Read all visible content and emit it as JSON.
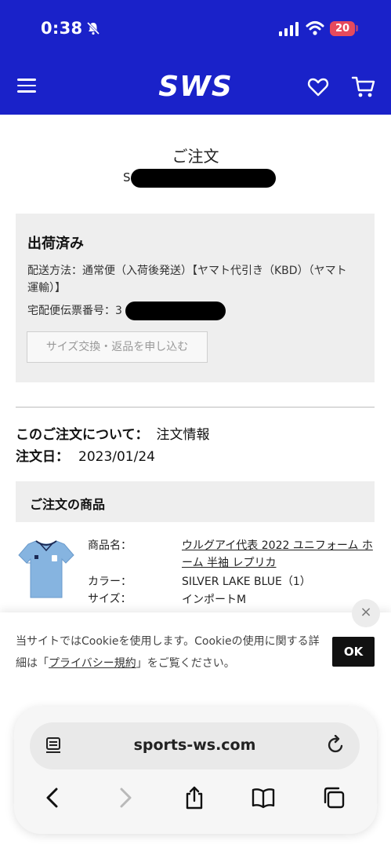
{
  "status_bar": {
    "time": "0:38",
    "battery": "20"
  },
  "header": {
    "logo": "SWS"
  },
  "order": {
    "title": "ご注文",
    "number_prefix": "S"
  },
  "shipment": {
    "status": "出荷済み",
    "method": "配送方法：通常便（入荷後発送）【ヤマト代引き（KBD）（ヤマト運輸）】",
    "tracking_label": "宅配便伝票番号：3",
    "return_button": "サイズ交換・返品を申し込む"
  },
  "order_info": {
    "about_label": "このご注文について：",
    "about_value": "注文情報",
    "date_label": "注文日：",
    "date_value": "2023/01/24"
  },
  "items": {
    "section_title": "ご注文の商品",
    "labels": {
      "name": "商品名：",
      "color": "カラー：",
      "size": "サイズ："
    },
    "product": {
      "name": "ウルグアイ代表 2022 ユニフォーム ホーム 半袖 レプリカ",
      "color": "SILVER LAKE BLUE（1）",
      "size": "インポートM"
    }
  },
  "cookie": {
    "text_before": "当サイトではCookieを使用します。Cookieの使用に関する詳細は「",
    "link": "プライバシー規約",
    "text_after": "」をご覧ください。",
    "ok": "OK",
    "close": "×"
  },
  "browser": {
    "url": "sports-ws.com"
  },
  "colors": {
    "header_bg": "#1a22c9",
    "panel_bg": "#eeeeee",
    "battery": "#e64a5d"
  }
}
